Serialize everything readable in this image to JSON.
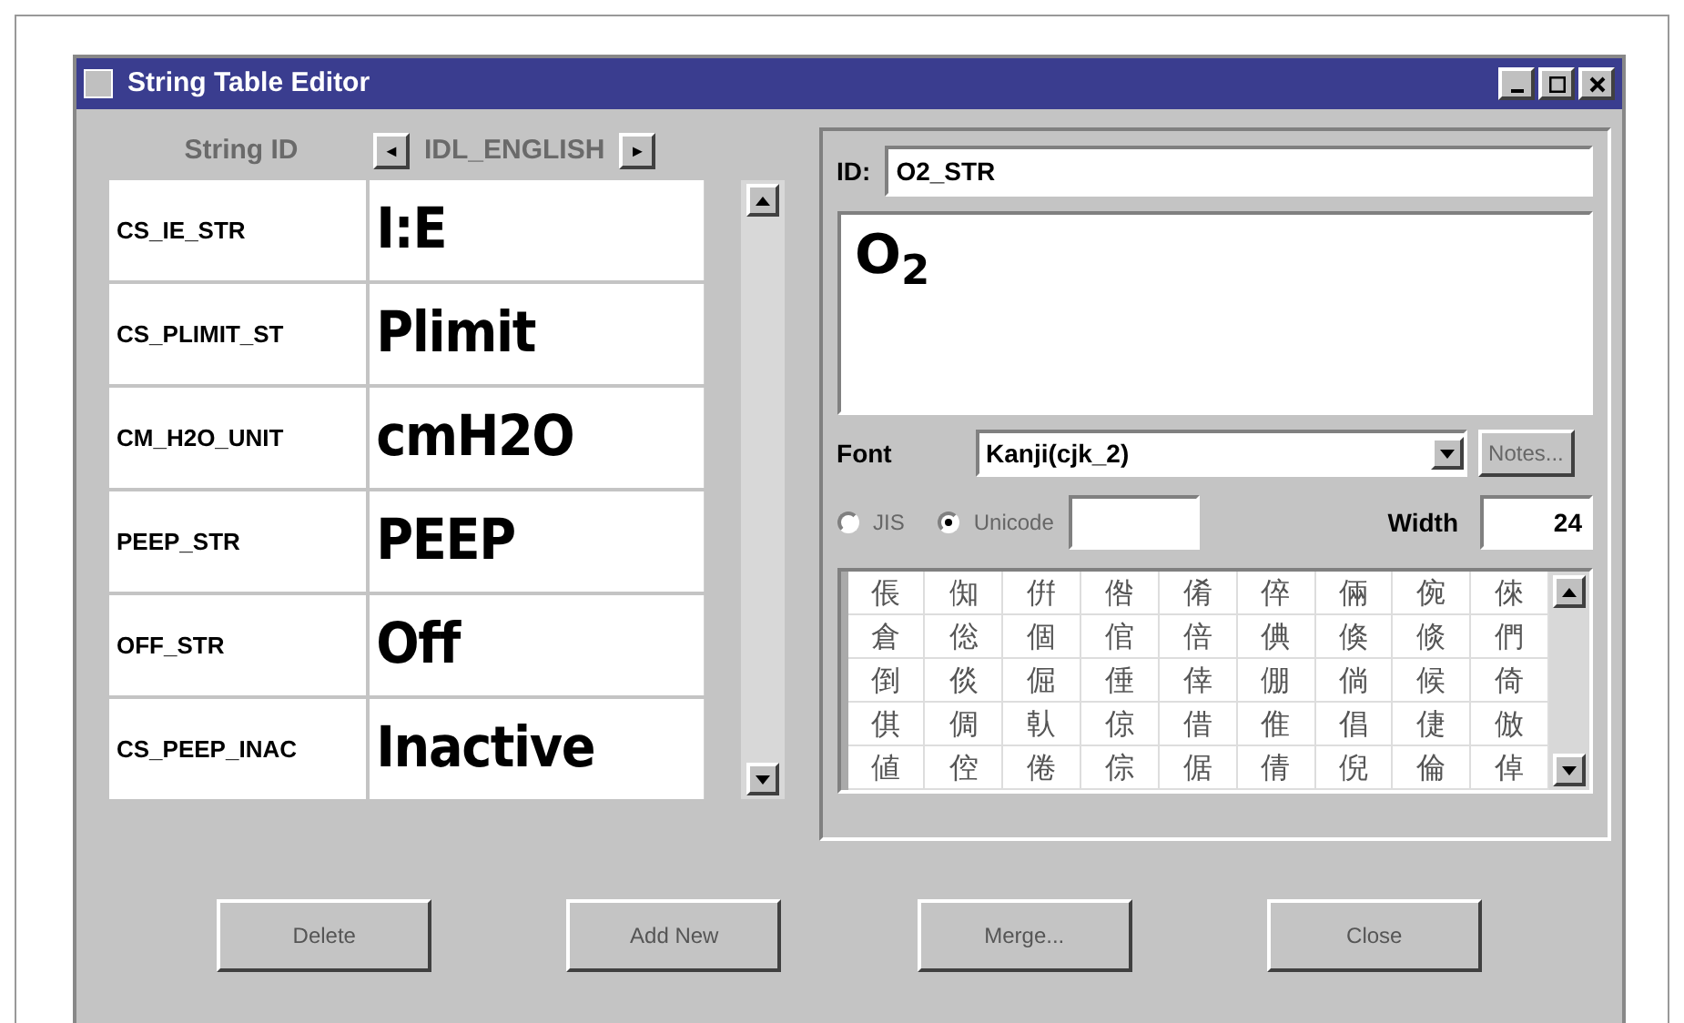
{
  "window": {
    "title": "String Table Editor"
  },
  "table": {
    "id_header": "String ID",
    "language": "IDL_ENGLISH",
    "prev": "◄",
    "next": "►",
    "rows": [
      {
        "id": "CS_IE_STR",
        "text": "I:E"
      },
      {
        "id": "CS_PLIMIT_ST",
        "text": "Plimit"
      },
      {
        "id": "CM_H2O_UNIT",
        "text": "cmH2O"
      },
      {
        "id": "PEEP_STR",
        "text": "PEEP"
      },
      {
        "id": "OFF_STR",
        "text": "Off"
      },
      {
        "id": "CS_PEEP_INAC",
        "text": "Inactive"
      }
    ]
  },
  "editor": {
    "id_label": "ID:",
    "id_value": "O2_STR",
    "text": "O$_{2}$",
    "font_label": "Font",
    "font_value": "Kanji(cjk_2)",
    "notes_button": "Notes...",
    "encodings": [
      {
        "label": "JIS",
        "selected": false
      },
      {
        "label": "Unicode",
        "selected": true
      }
    ],
    "width_label": "Width",
    "width_value": "24",
    "glyphs": [
      [
        "倀",
        "倁",
        "倂",
        "倃",
        "倄",
        "倅",
        "倆",
        "倇",
        "倈"
      ],
      [
        "倉",
        "倊",
        "個",
        "倌",
        "倍",
        "倎",
        "倏",
        "倐",
        "們"
      ],
      [
        "倒",
        "倓",
        "倔",
        "倕",
        "倖",
        "倗",
        "倘",
        "候",
        "倚"
      ],
      [
        "倛",
        "倜",
        "倝",
        "倞",
        "借",
        "倠",
        "倡",
        "倢",
        "倣"
      ],
      [
        "値",
        "倥",
        "倦",
        "倧",
        "倨",
        "倩",
        "倪",
        "倫",
        "倬"
      ]
    ]
  },
  "buttons": [
    "Delete",
    "Add New",
    "Merge...",
    "Close"
  ]
}
